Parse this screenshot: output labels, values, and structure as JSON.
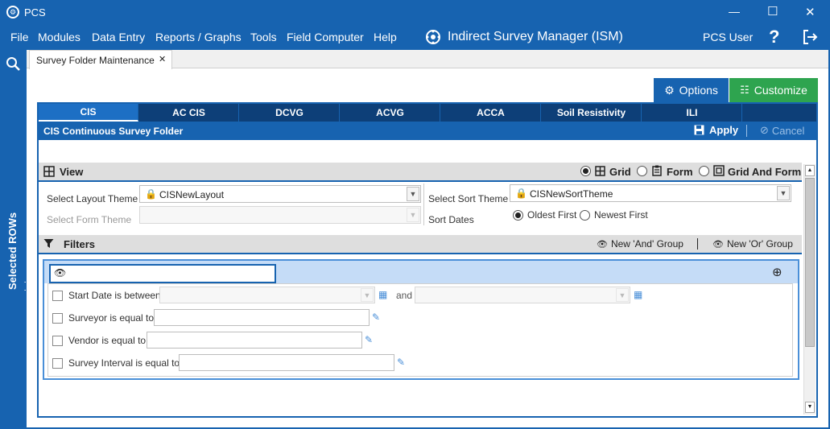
{
  "app": {
    "title": "PCS",
    "module_title": "Indirect Survey Manager (ISM)",
    "user": "PCS User",
    "help": "?"
  },
  "window": {
    "minimize": "—",
    "maximize": "☐",
    "close": "✕"
  },
  "menu": [
    "File",
    "Modules",
    "Data Entry",
    "Reports / Graphs",
    "Tools",
    "Field Computer",
    "Help"
  ],
  "sidebar": {
    "label": "Selected ROWs",
    "dots": "⋮⋮"
  },
  "doc_tab": {
    "label": "Survey Folder Maintenance",
    "close": "✕"
  },
  "toolbar": {
    "options": "Options",
    "customize": "Customize"
  },
  "survey_tabs": [
    "CIS",
    "AC CIS",
    "DCVG",
    "ACVG",
    "ACCA",
    "Soil Resistivity",
    "ILI"
  ],
  "folder": {
    "title": "CIS Continuous Survey Folder",
    "apply": "Apply",
    "cancel": "Cancel"
  },
  "view": {
    "header": "View",
    "modes": [
      "Grid",
      "Form",
      "Grid And Form"
    ],
    "selected": "Grid",
    "layout_theme_label": "Select Layout Theme",
    "layout_theme_value": "CISNewLayout",
    "form_theme_label": "Select Form Theme",
    "form_theme_value": "",
    "sort_theme_label": "Select Sort Theme",
    "sort_theme_value": "CISNewSortTheme",
    "sort_dates_label": "Sort Dates",
    "sort_options": [
      "Oldest First",
      "Newest First"
    ],
    "sort_selected": "Oldest First"
  },
  "filters": {
    "header": "Filters",
    "new_and": "New 'And' Group",
    "new_or": "New 'Or' Group",
    "group_input": "",
    "rows": [
      {
        "label": "Start Date is between",
        "value": "",
        "and": "and",
        "value2": ""
      },
      {
        "label": "Surveyor is equal to",
        "value": ""
      },
      {
        "label": "Vendor is equal to",
        "value": ""
      },
      {
        "label": "Survey Interval is equal to",
        "value": ""
      }
    ]
  },
  "colors": {
    "primary": "#1763b0",
    "dark_tab": "#0d3f78",
    "green": "#2ea44f"
  }
}
